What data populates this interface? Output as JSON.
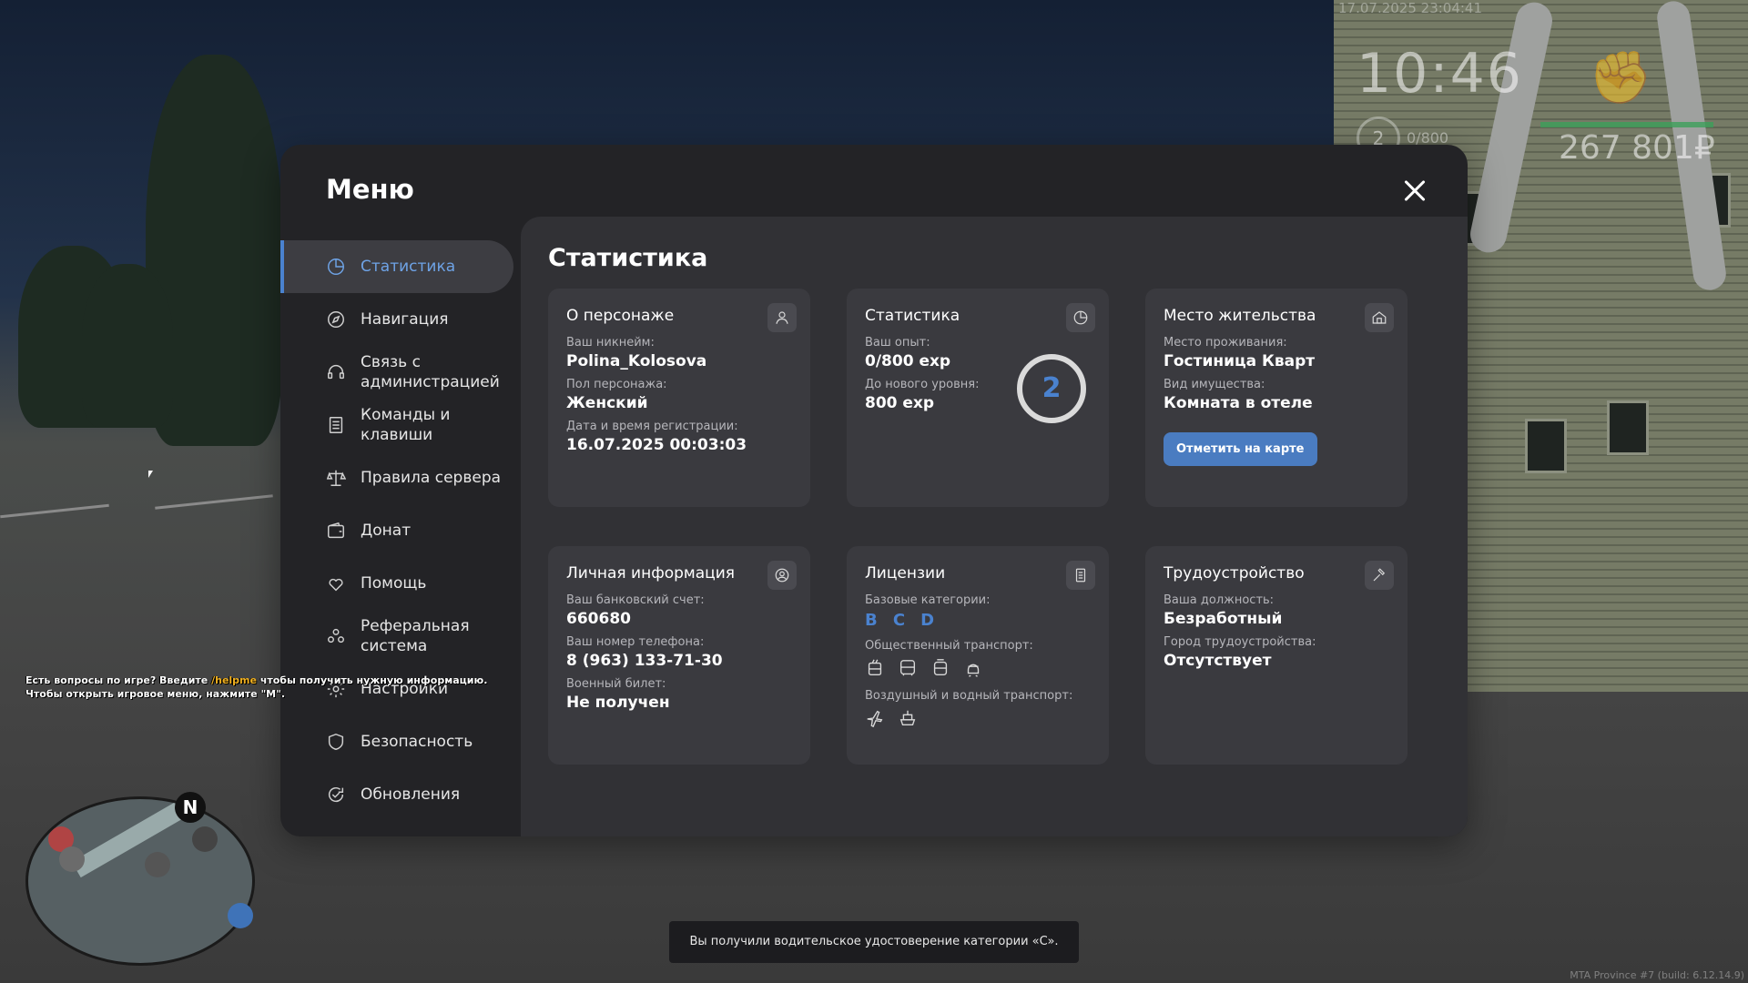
{
  "hud": {
    "datetime": "17.07.2025 23:04:41",
    "time": "10:46",
    "level": "2",
    "exp": "0/800",
    "money": "267 801₽"
  },
  "menu": {
    "title": "Меню",
    "sidebar": [
      {
        "label": "Статистика",
        "icon": "pie-chart-icon",
        "active": true
      },
      {
        "label": "Навигация",
        "icon": "compass-icon"
      },
      {
        "label": "Связь с\nадминистрацией",
        "icon": "headset-icon"
      },
      {
        "label": "Команды и\nклавиши",
        "icon": "document-icon"
      },
      {
        "label": "Правила сервера",
        "icon": "scales-icon"
      },
      {
        "label": "Донат",
        "icon": "wallet-icon"
      },
      {
        "label": "Помощь",
        "icon": "heart-hand-icon"
      },
      {
        "label": "Реферальная\nсистема",
        "icon": "people-icon"
      },
      {
        "label": "Настройки",
        "icon": "gear-icon"
      },
      {
        "label": "Безопасность",
        "icon": "shield-icon"
      },
      {
        "label": "Обновления",
        "icon": "refresh-check-icon"
      }
    ]
  },
  "content": {
    "title": "Статистика",
    "character": {
      "title": "О персонаже",
      "nick_label": "Ваш никнейм:",
      "nick": "Polina_Kolosova",
      "gender_label": "Пол персонажа:",
      "gender": "Женский",
      "reg_label": "Дата и время регистрации:",
      "reg": "16.07.2025 00:03:03"
    },
    "stats": {
      "title": "Статистика",
      "exp_label": "Ваш опыт:",
      "exp": "0/800 exp",
      "next_label": "До нового уровня:",
      "next": "800 exp",
      "level": "2",
      "progress": 0
    },
    "residence": {
      "title": "Место жительства",
      "place_label": "Место проживания:",
      "place": "Гостиница Кварт",
      "type_label": "Вид имущества:",
      "type": "Комната в отеле",
      "button": "Отметить на карте"
    },
    "personal": {
      "title": "Личная информация",
      "bank_label": "Ваш банковский счет:",
      "bank": "660680",
      "phone_label": "Ваш номер телефона:",
      "phone": "8 (963) 133-71-30",
      "military_label": "Военный билет:",
      "military": "Не получен"
    },
    "licenses": {
      "title": "Лицензии",
      "base_label": "Базовые категории:",
      "categories": [
        "B",
        "C",
        "D"
      ],
      "public_label": "Общественный транспорт:",
      "public_icons": [
        "trolleybus-icon",
        "bus-icon",
        "tram-icon",
        "subway-icon"
      ],
      "air_label": "Воздушный и водный транспорт:",
      "air_icons": [
        "plane-icon",
        "ship-icon"
      ]
    },
    "job": {
      "title": "Трудоустройство",
      "position_label": "Ваша должность:",
      "position": "Безработный",
      "city_label": "Город трудоустройства:",
      "city": "Отсутствует"
    }
  },
  "chat": {
    "line1_a": "Есть вопросы по игре? Введите ",
    "line1_cmd": "/helpme",
    "line1_b": " чтобы получить нужную информацию.",
    "line2": "Чтобы открыть игровое меню, нажмите \"M\"."
  },
  "minimap": {
    "north": "N"
  },
  "toast": "Вы получили водительское удостоверение категории «C».",
  "build": "MTA Province #7 (build: 6.12.14.9)",
  "colors": {
    "accent": "#4a82cf",
    "panel": "#232326",
    "card": "#3a3a3f"
  }
}
